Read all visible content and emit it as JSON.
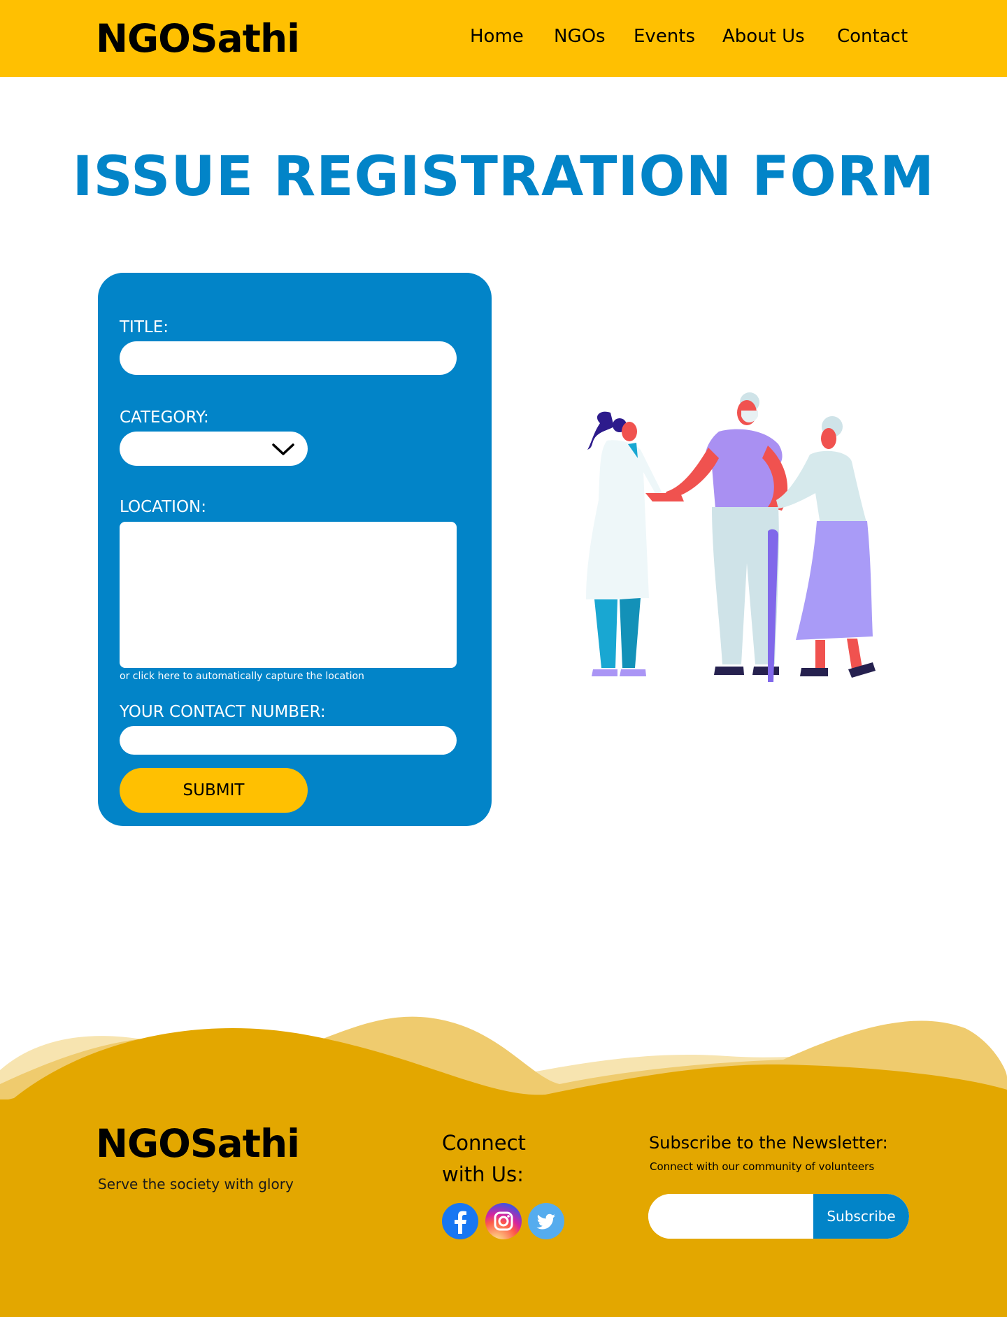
{
  "header": {
    "brand": "NGOSathi",
    "nav": [
      "Home",
      "NGOs",
      "Events",
      "About Us",
      "Contact"
    ]
  },
  "page": {
    "title": "ISSUE REGISTRATION FORM"
  },
  "form": {
    "title_label": "TITLE:",
    "title_value": "",
    "category_label": "CATEGORY:",
    "category_value": "",
    "location_label": "LOCATION:",
    "location_value": "",
    "location_hint": "or click here to automatically capture the location",
    "contact_label": "YOUR CONTACT NUMBER:",
    "contact_value": "",
    "submit_label": "SUBMIT"
  },
  "illustration": {
    "icon": "doctor-with-elderly-couple-illustration"
  },
  "footer": {
    "brand": "NGOSathi",
    "tagline": "Serve the society with glory",
    "connect_line1": "Connect",
    "connect_line2": "with Us:",
    "social": [
      "facebook-icon",
      "instagram-icon",
      "twitter-icon"
    ],
    "newsletter_title": "Subscribe to the Newsletter:",
    "newsletter_sub": "Connect with our community of volunteers",
    "newsletter_value": "",
    "subscribe_label": "Subscribe"
  },
  "colors": {
    "header_bg": "#ffc001",
    "primary_blue": "#0284c8",
    "footer_bg": "#e3a700",
    "submit_bg": "#ffc001"
  }
}
